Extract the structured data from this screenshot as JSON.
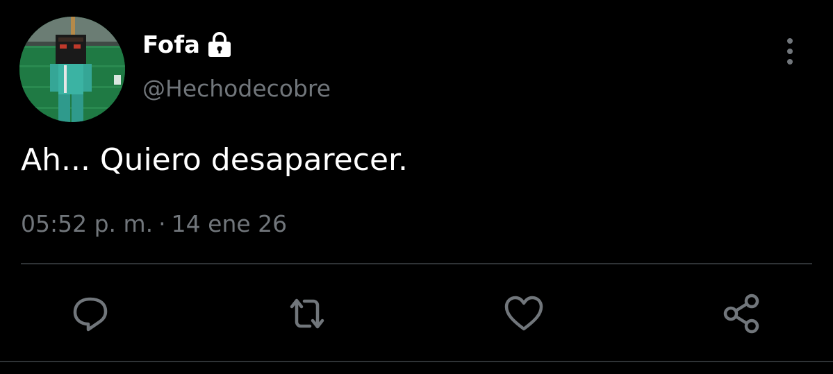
{
  "user": {
    "display_name": "Fofa",
    "handle": "@Hechodecobre",
    "protected_icon": "lock-icon",
    "avatar_icon": "avatar-minecraft-character"
  },
  "tweet": {
    "text": "Ah... Quiero desaparecer.",
    "time": "05:52 p. m.",
    "separator": "·",
    "date": "14 ene 26"
  },
  "actions": {
    "reply_icon": "reply-icon",
    "retweet_icon": "retweet-icon",
    "like_icon": "heart-icon",
    "share_icon": "share-icon",
    "more_icon": "more-vertical-icon"
  },
  "colors": {
    "background": "#000000",
    "primary_text": "#ffffff",
    "secondary_text": "#71767b",
    "divider": "#2f3336"
  }
}
